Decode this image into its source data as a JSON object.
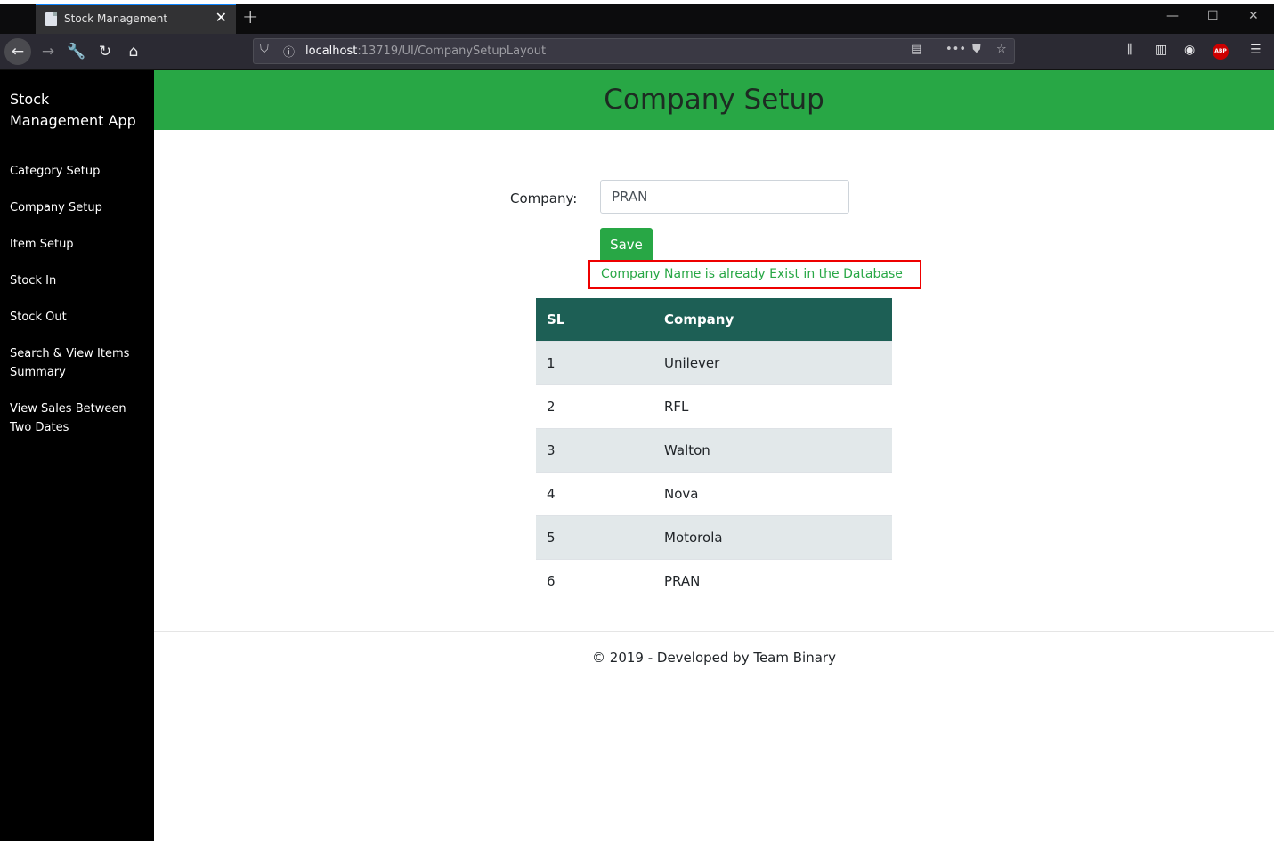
{
  "browser": {
    "tab_title": "Stock Management",
    "url_host": "localhost",
    "url_path": ":13719/UI/CompanySetupLayout",
    "abp_label": "ABP"
  },
  "sidebar": {
    "brand": "Stock Management App",
    "items": [
      {
        "label": "Category Setup"
      },
      {
        "label": "Company Setup"
      },
      {
        "label": "Item Setup"
      },
      {
        "label": "Stock In"
      },
      {
        "label": "Stock Out"
      },
      {
        "label": "Search & View Items Summary"
      },
      {
        "label": "View Sales Between Two Dates"
      }
    ]
  },
  "page": {
    "title": "Company Setup",
    "form": {
      "company_label": "Company:",
      "company_value": "PRAN",
      "save_label": "Save",
      "message": "Company Name is already Exist in the Database"
    },
    "table": {
      "headers": [
        "SL",
        "Company"
      ],
      "rows": [
        {
          "sl": "1",
          "company": "Unilever"
        },
        {
          "sl": "2",
          "company": "RFL"
        },
        {
          "sl": "3",
          "company": "Walton"
        },
        {
          "sl": "4",
          "company": "Nova"
        },
        {
          "sl": "5",
          "company": "Motorola"
        },
        {
          "sl": "6",
          "company": "PRAN"
        }
      ]
    },
    "footer": "© 2019 - Developed by Team Binary"
  },
  "colors": {
    "header_green": "#28a745",
    "table_header": "#1d5f55",
    "message_border": "#e00000"
  }
}
